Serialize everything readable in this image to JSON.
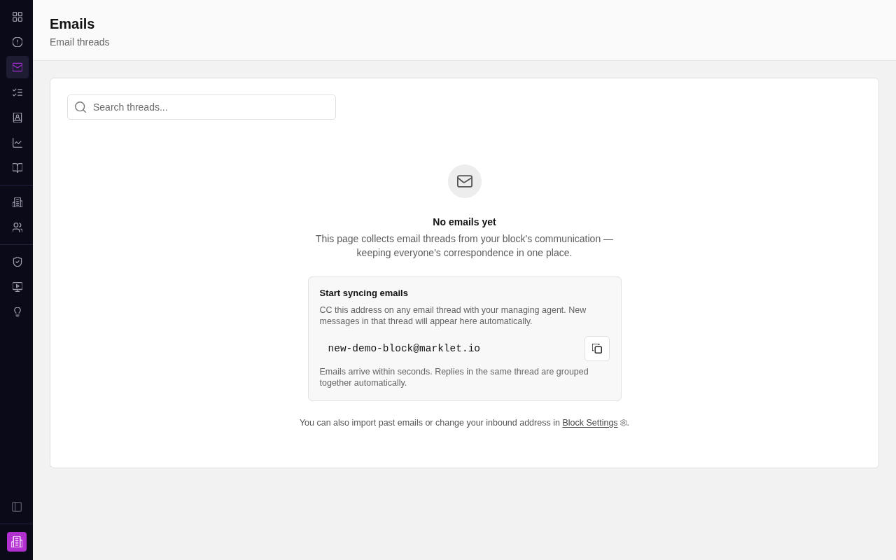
{
  "sidebar": {
    "groups": [
      {
        "items": [
          {
            "selected": false
          },
          {
            "selected": false
          },
          {
            "selected": true
          },
          {
            "selected": false
          },
          {
            "selected": false
          },
          {
            "selected": false
          },
          {
            "selected": false
          }
        ]
      },
      {
        "items": [
          {
            "selected": false
          },
          {
            "selected": false
          }
        ]
      },
      {
        "items": [
          {
            "selected": false
          },
          {
            "selected": false
          },
          {
            "selected": false
          }
        ]
      }
    ]
  },
  "header": {
    "title": "Emails",
    "subtitle": "Email threads"
  },
  "search": {
    "placeholder": "Search threads..."
  },
  "empty_state": {
    "title": "No emails yet",
    "description": "This page collects email threads from your block's communication — keeping everyone's correspondence in one place."
  },
  "sync_card": {
    "title": "Start syncing emails",
    "description": "CC this address on any email thread with your managing agent. New messages in that thread will appear here automatically.",
    "address": "new-demo-block@marklet.io",
    "note": "Emails arrive within seconds. Replies in the same thread are grouped together automatically."
  },
  "footer_note": {
    "text": "You can also import past emails or change your inbound address in ",
    "link": "Block Settings",
    "suffix": "."
  }
}
